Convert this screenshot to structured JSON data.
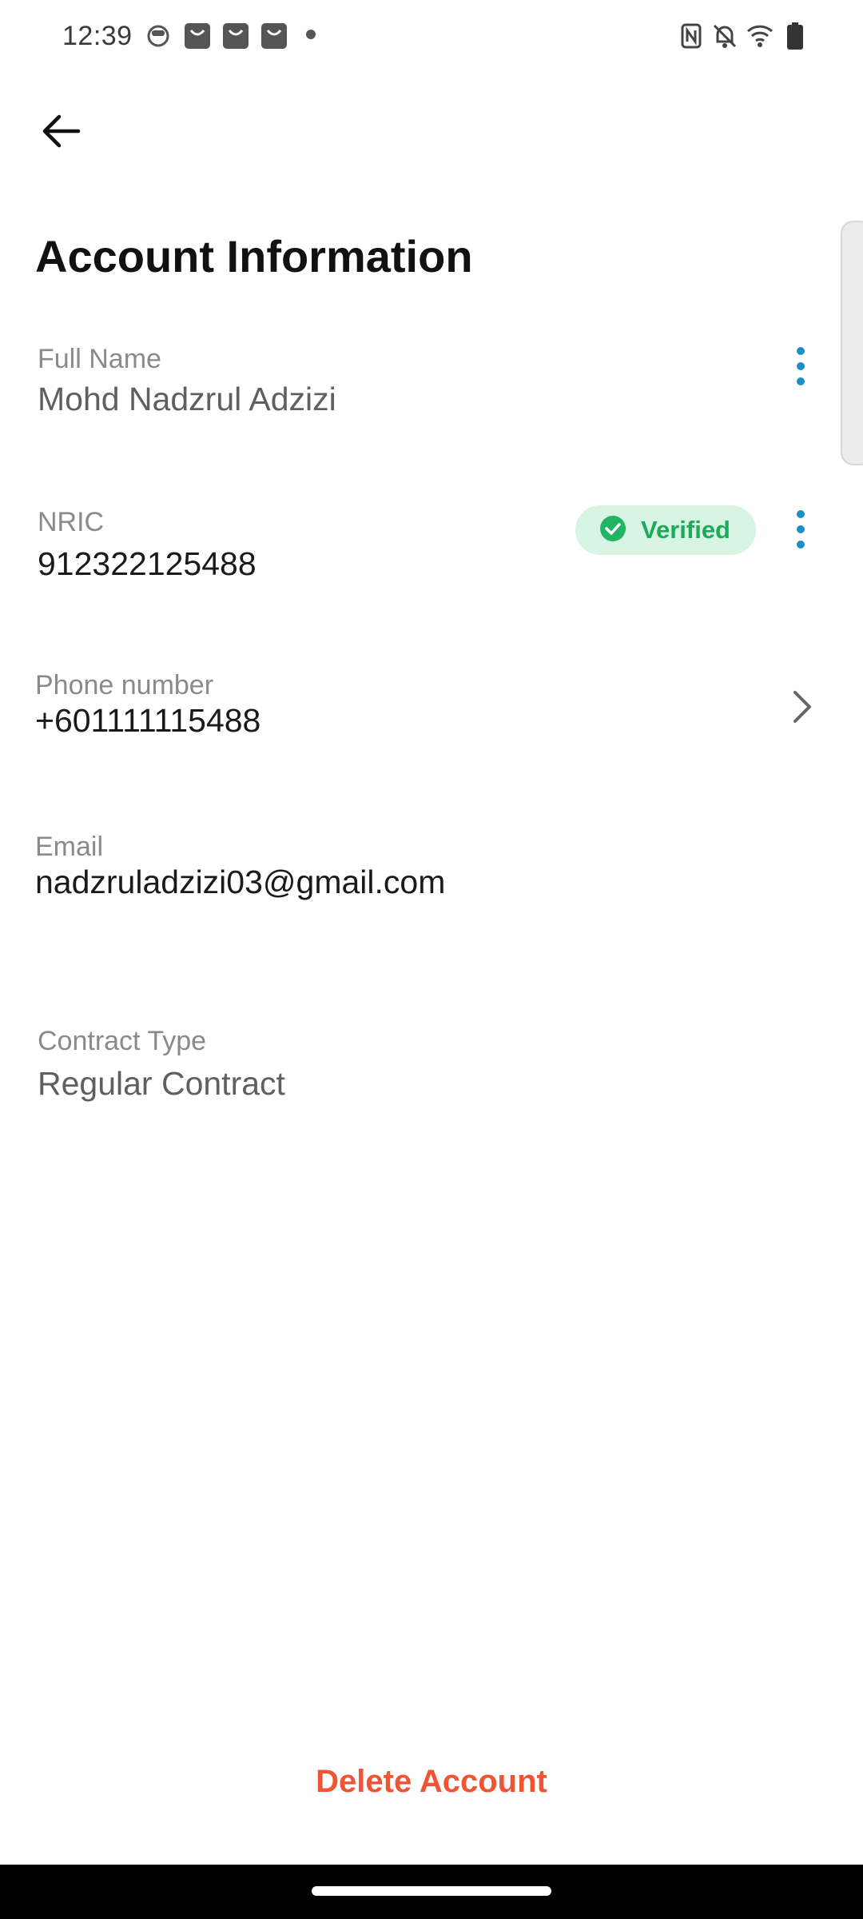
{
  "status_bar": {
    "time": "12:39",
    "left_icons": [
      "face-icon",
      "shopping-bag-icon",
      "shopping-bag-icon",
      "shopping-bag-icon",
      "dot-icon"
    ],
    "right_icons": [
      "nfc-icon",
      "bell-off-icon",
      "wifi-icon",
      "battery-icon"
    ]
  },
  "header": {
    "back_icon": "arrow-left-icon",
    "title": "Account Information"
  },
  "fields": {
    "full_name": {
      "label": "Full Name",
      "value": "Mohd Nadzrul Adzizi",
      "menu_icon": "more-vert-icon"
    },
    "nric": {
      "label": "NRIC",
      "value": "912322125488",
      "badge": "Verified",
      "badge_icon": "check-circle-icon",
      "menu_icon": "more-vert-icon"
    },
    "phone": {
      "label": "Phone number",
      "value": "+601111115488",
      "action_icon": "chevron-right-icon"
    },
    "email": {
      "label": "Email",
      "value": "nadzruladzizi03@gmail.com"
    },
    "contract_type": {
      "label": "Contract Type",
      "value": "Regular Contract"
    }
  },
  "footer": {
    "delete_label": "Delete Account"
  },
  "colors": {
    "accent": "#1c8fc4",
    "verified_bg": "#d8f5e3",
    "verified_text": "#1faa5b",
    "danger": "#ef5534"
  }
}
